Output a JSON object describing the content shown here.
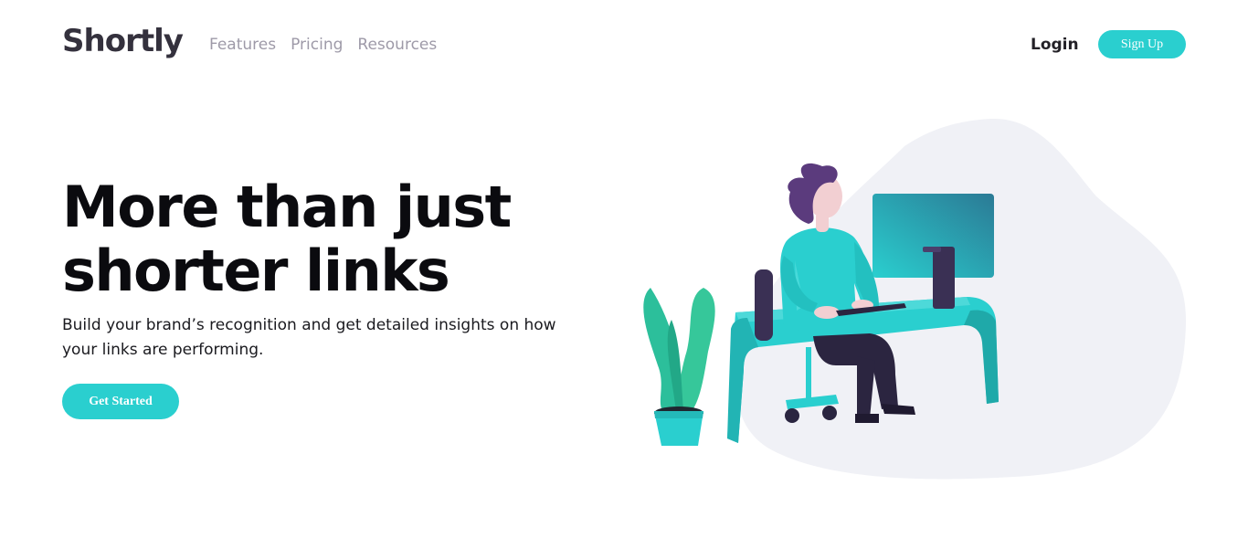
{
  "brand": {
    "logo": "Shortly"
  },
  "nav": {
    "items": [
      {
        "label": "Features"
      },
      {
        "label": "Pricing"
      },
      {
        "label": "Resources"
      }
    ],
    "login_label": "Login",
    "signup_label": "Sign Up"
  },
  "hero": {
    "headline_line1": "More than just",
    "headline_line2": "shorter links",
    "subtext_line1": "Build your brand’s recognition and get detailed insights on how",
    "subtext_line2": "your links are performing.",
    "cta_label": "Get Started"
  },
  "colors": {
    "accent": "#2acfcf",
    "dark": "#34313d",
    "gray": "#9e9aa8",
    "blob": "#f0f1f6"
  },
  "icons": {
    "illustration": "working-person-illustration"
  }
}
